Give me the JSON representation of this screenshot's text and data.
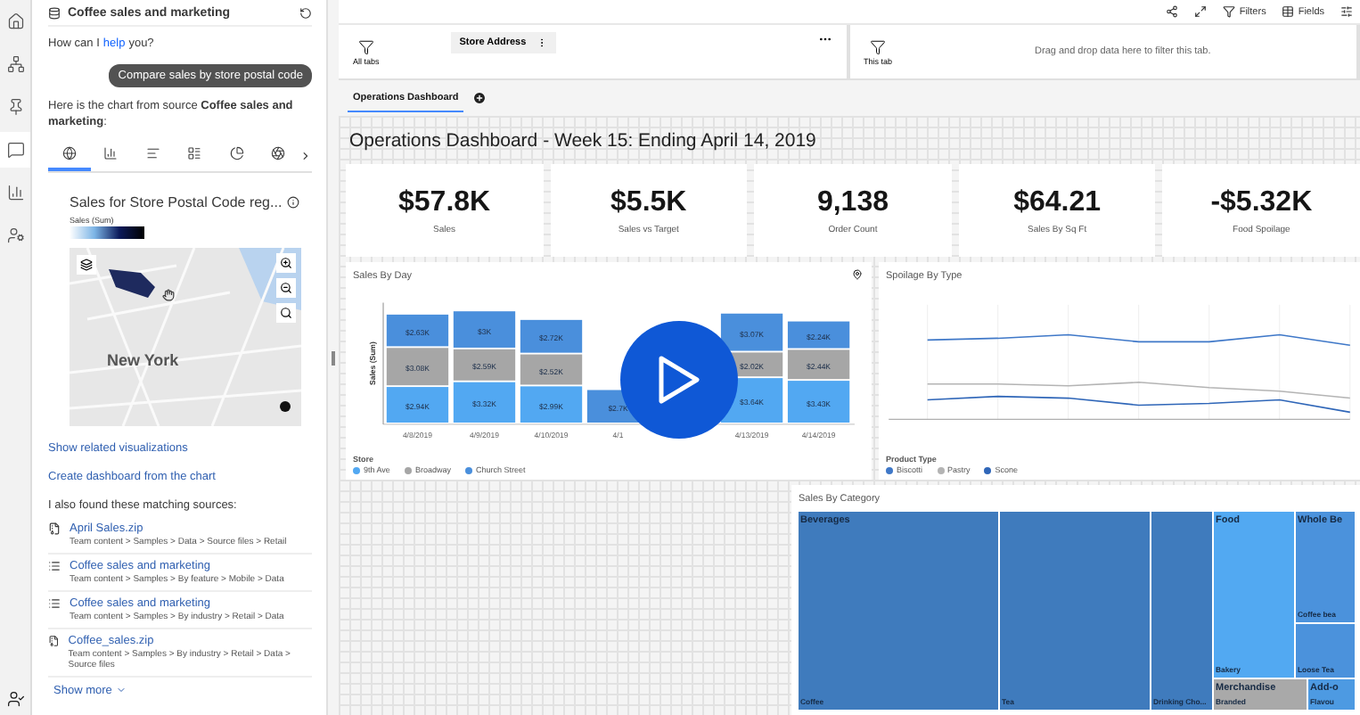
{
  "rail": {
    "items": [
      {
        "kind": "home",
        "selected": false
      },
      {
        "kind": "hierarchy",
        "selected": false
      },
      {
        "kind": "pin",
        "selected": false
      },
      {
        "kind": "chat",
        "selected": true
      },
      {
        "kind": "chart",
        "selected": false
      },
      {
        "kind": "user-settings",
        "selected": false
      }
    ]
  },
  "assistant": {
    "title": "Coffee sales and marketing",
    "greeting_before": "How can I",
    "greeting_link": "help",
    "greeting_after": "you?",
    "user_message": "Compare sales by store postal code",
    "reply": "Here is the chart from source **Coffee sales and marketing**:",
    "chart_tabs": [
      {
        "kind": "map",
        "selected": true
      },
      {
        "kind": "column",
        "selected": false
      },
      {
        "kind": "bar",
        "selected": false
      },
      {
        "kind": "list",
        "selected": false
      },
      {
        "kind": "pie",
        "selected": false
      },
      {
        "kind": "radial",
        "selected": false
      }
    ],
    "chart_title": "Sales for Store Postal Code reg...",
    "legend_title": "Sales (Sum)",
    "map_label": "New York",
    "links": [
      "Show related visualizations",
      "Create dashboard from the chart"
    ],
    "sources_heading": "I also found these matching sources:",
    "sources": [
      {
        "kind": "file",
        "name": "April Sales.zip",
        "path": "Team content > Samples > Data > Source files > Retail"
      },
      {
        "kind": "dataset",
        "name": "Coffee sales and marketing",
        "path": "Team content > Samples > By feature > Mobile > Data"
      },
      {
        "kind": "dataset",
        "name": "Coffee sales and marketing",
        "path": "Team content > Samples > By industry > Retail > Data"
      },
      {
        "kind": "file",
        "name": "Coffee_sales.zip",
        "path": "Team content > Samples > By industry > Retail > Data > Source files"
      }
    ],
    "show_more": "Show more"
  },
  "toolbar": {
    "filters": "Filters",
    "fields": "Fields"
  },
  "filters": {
    "all_tabs": "All tabs",
    "pill": "Store Address",
    "this_tab": "This tab",
    "drop_hint": "Drag and drop data here to filter this tab."
  },
  "tabs": [
    {
      "label": "Operations Dashboard",
      "selected": true
    }
  ],
  "dashboard": {
    "title": "Operations Dashboard - Week 15: Ending April 14, 2019",
    "kpis": [
      {
        "value": "$57.8K",
        "label": "Sales"
      },
      {
        "value": "$5.5K",
        "label": "Sales vs Target"
      },
      {
        "value": "9,138",
        "label": "Order Count"
      },
      {
        "value": "$64.21",
        "label": "Sales By Sq Ft"
      },
      {
        "value": "-$5.32K",
        "label": "Food Spoilage"
      }
    ],
    "sales_by_day": {
      "legend_title": "Store",
      "chart_data": {
        "type": "bar",
        "title": "Sales By Day",
        "ylabel": "Sales (Sum)",
        "stacked": true,
        "categories": [
          "4/8/2019",
          "4/9/2019",
          "4/10/2019",
          "4/1",
          null,
          "4/13/2019",
          "4/14/2019"
        ],
        "series": [
          {
            "name": "9th Ave",
            "color": "#52a8f2",
            "values": [
              2.94,
              3.32,
              2.99,
              null,
              null,
              3.64,
              3.43
            ],
            "value_labels": [
              "$2.94K",
              "$3.32K",
              "$2.99K",
              null,
              null,
              "$3.64K",
              "$3.43K"
            ]
          },
          {
            "name": "Broadway",
            "color": "#a6a6a6",
            "values": [
              3.08,
              2.59,
              2.52,
              null,
              null,
              2.02,
              2.44
            ],
            "value_labels": [
              "$3.08K",
              "$2.59K",
              "$2.52K",
              null,
              null,
              "$2.02K",
              "$2.44K"
            ]
          },
          {
            "name": "Church Street",
            "color": "#4a8fdc",
            "values": [
              2.63,
              3,
              2.72,
              2.7,
              null,
              3.07,
              2.24
            ],
            "value_labels": [
              "$2.63K",
              "$3K",
              "$2.72K",
              "$2.7K",
              null,
              "$3.07K",
              "$2.24K"
            ]
          }
        ]
      }
    },
    "spoilage": {
      "title": "Spoilage By Type",
      "legend_title": "Product Type",
      "legend": [
        {
          "name": "Biscotti",
          "color": "#3f78c8"
        },
        {
          "name": "Pastry",
          "color": "#b4b4b4"
        },
        {
          "name": "Scone",
          "color": "#2f66b8"
        }
      ]
    },
    "category": {
      "title": "Sales By Category",
      "groups": [
        {
          "name": "Beverages",
          "color": "#3f7bbd",
          "leaves": [
            "Coffee",
            "Tea",
            "Drinking Cho..."
          ]
        },
        {
          "name": "Food",
          "color": "#52a9f2",
          "leaves": [
            "Bakery"
          ]
        },
        {
          "name": "Whole Be",
          "color": "#4b92dc",
          "leaves": [
            "Coffee bea",
            "Loose Tea"
          ]
        },
        {
          "name": "Merchandise",
          "color": "#a9a9a9",
          "leaves": [
            "Branded"
          ]
        },
        {
          "name": "Add-o",
          "color": "#4d9ae2",
          "leaves": [
            "Flavou"
          ]
        }
      ]
    }
  }
}
